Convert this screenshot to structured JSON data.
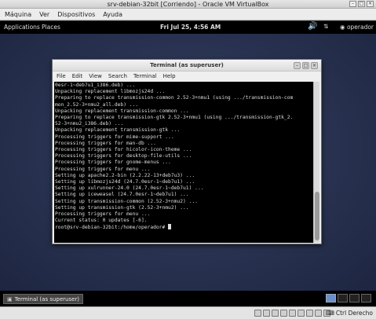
{
  "vbox": {
    "title": "srv-debian-32bit [Corriendo] - Oracle VM VirtualBox",
    "menu": [
      "Máquina",
      "Ver",
      "Dispositivos",
      "Ayuda"
    ],
    "hostkey": "Ctrl Derecho"
  },
  "gnome": {
    "applications": "Applications",
    "places": "Places",
    "clock": "Fri Jul 25,  4:56 AM",
    "user": "operador",
    "taskbar_item": "Terminal (as superuser)"
  },
  "terminal": {
    "title": "Terminal (as superuser)",
    "menu": [
      "File",
      "Edit",
      "View",
      "Search",
      "Terminal",
      "Help"
    ],
    "lines": [
      "0esr-1~deb7u1_i386.deb) ...",
      "Unpacking replacement libmozjs24d ...",
      "Preparing to replace transmission-common 2.52-3+nmu1 (using .../transmission-com",
      "mon_2.52-3+nmu2_all.deb) ...",
      "Unpacking replacement transmission-common ...",
      "Preparing to replace transmission-gtk 2.52-3+nmu1 (using .../transmission-gtk_2.",
      "52-3+nmu2_i386.deb) ...",
      "Unpacking replacement transmission-gtk ...",
      "Processing triggers for mime-support ...",
      "Processing triggers for man-db ...",
      "Processing triggers for hicolor-icon-theme ...",
      "Processing triggers for desktop-file-utils ...",
      "Processing triggers for gnome-menus ...",
      "Processing triggers for menu ...",
      "Setting up apache2.2-bin (2.2.22-13+deb7u3) ...",
      "Setting up libmozjs24d (24.7.0esr-1~deb7u1) ...",
      "Setting up xulrunner-24.0 (24.7.0esr-1~deb7u1) ...",
      "Setting up iceweasel (24.7.0esr-1~deb7u1) ...",
      "Setting up transmission-common (2.52-3+nmu2) ...",
      "Setting up transmission-gtk (2.52-3+nmu2) ...",
      "Processing triggers for menu ...",
      "",
      "Current status: 0 updates [-6].",
      "root@srv-debian-32bit:/home/operador# "
    ]
  }
}
